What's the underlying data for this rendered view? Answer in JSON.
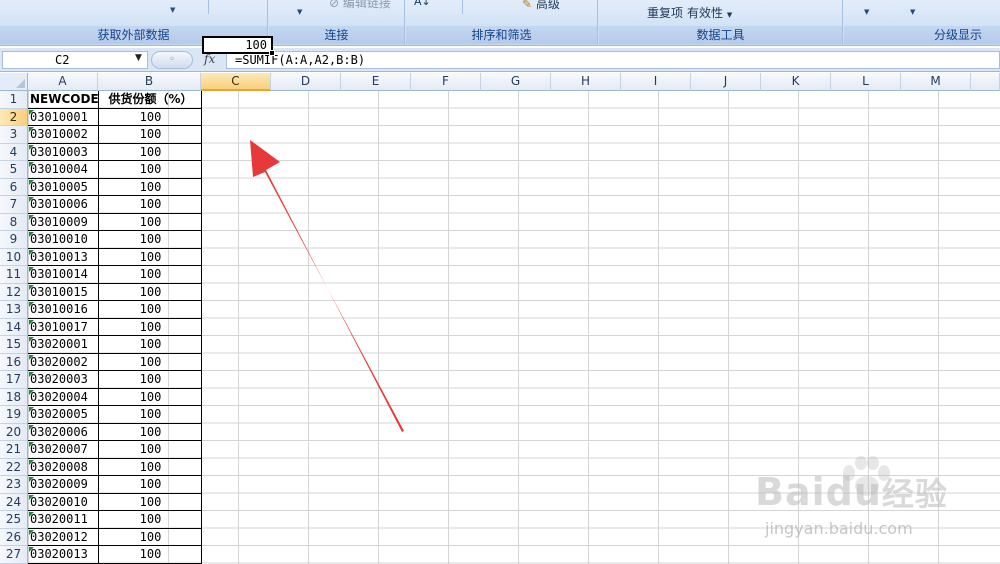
{
  "ribbon": {
    "groups": [
      {
        "label": "获取外部数据"
      },
      {
        "label": "连接",
        "items": [
          "编辑链接"
        ]
      },
      {
        "label": "排序和筛选",
        "items": [
          "高级"
        ]
      },
      {
        "label": "数据工具",
        "items": [
          "重复项",
          "有效性"
        ]
      },
      {
        "label": "分级显示"
      }
    ]
  },
  "formula_bar": {
    "name_box": "C2",
    "fx_label": "fx",
    "formula": "=SUMIF(A:A,A2,B:B)"
  },
  "sheet": {
    "columns": [
      "A",
      "B",
      "C",
      "D",
      "E",
      "F",
      "G",
      "H",
      "I",
      "J",
      "K",
      "L",
      "M"
    ],
    "active_column": "C",
    "active_row": "2",
    "header_row": {
      "row": "1",
      "a": "NEWCODE",
      "b": "供货份额（%）"
    },
    "rows": [
      {
        "row": "2",
        "a": "03010001",
        "b": "100"
      },
      {
        "row": "3",
        "a": "03010002",
        "b": "100"
      },
      {
        "row": "4",
        "a": "03010003",
        "b": "100"
      },
      {
        "row": "5",
        "a": "03010004",
        "b": "100"
      },
      {
        "row": "6",
        "a": "03010005",
        "b": "100"
      },
      {
        "row": "7",
        "a": "03010006",
        "b": "100"
      },
      {
        "row": "8",
        "a": "03010009",
        "b": "100"
      },
      {
        "row": "9",
        "a": "03010010",
        "b": "100"
      },
      {
        "row": "10",
        "a": "03010013",
        "b": "100"
      },
      {
        "row": "11",
        "a": "03010014",
        "b": "100"
      },
      {
        "row": "12",
        "a": "03010015",
        "b": "100"
      },
      {
        "row": "13",
        "a": "03010016",
        "b": "100"
      },
      {
        "row": "14",
        "a": "03010017",
        "b": "100"
      },
      {
        "row": "15",
        "a": "03020001",
        "b": "100"
      },
      {
        "row": "16",
        "a": "03020002",
        "b": "100"
      },
      {
        "row": "17",
        "a": "03020003",
        "b": "100"
      },
      {
        "row": "18",
        "a": "03020004",
        "b": "100"
      },
      {
        "row": "19",
        "a": "03020005",
        "b": "100"
      },
      {
        "row": "20",
        "a": "03020006",
        "b": "100"
      },
      {
        "row": "21",
        "a": "03020007",
        "b": "100"
      },
      {
        "row": "22",
        "a": "03020008",
        "b": "100"
      },
      {
        "row": "23",
        "a": "03020009",
        "b": "100"
      },
      {
        "row": "24",
        "a": "03020010",
        "b": "100"
      },
      {
        "row": "25",
        "a": "03020011",
        "b": "100"
      },
      {
        "row": "26",
        "a": "03020012",
        "b": "100"
      },
      {
        "row": "27",
        "a": "03020013",
        "b": "100"
      }
    ],
    "active_cell_value": "100"
  },
  "annotation": {
    "arrow_color": "#e8393a"
  },
  "watermark": {
    "brand": "Bai",
    "brand_tail": "du",
    "suffix": "经验",
    "url": "jingyan.baidu.com"
  },
  "colors": {
    "ribbon_label": "#15428b",
    "active_header": "#f8cf7d",
    "grid_line": "#d4d4d4"
  }
}
